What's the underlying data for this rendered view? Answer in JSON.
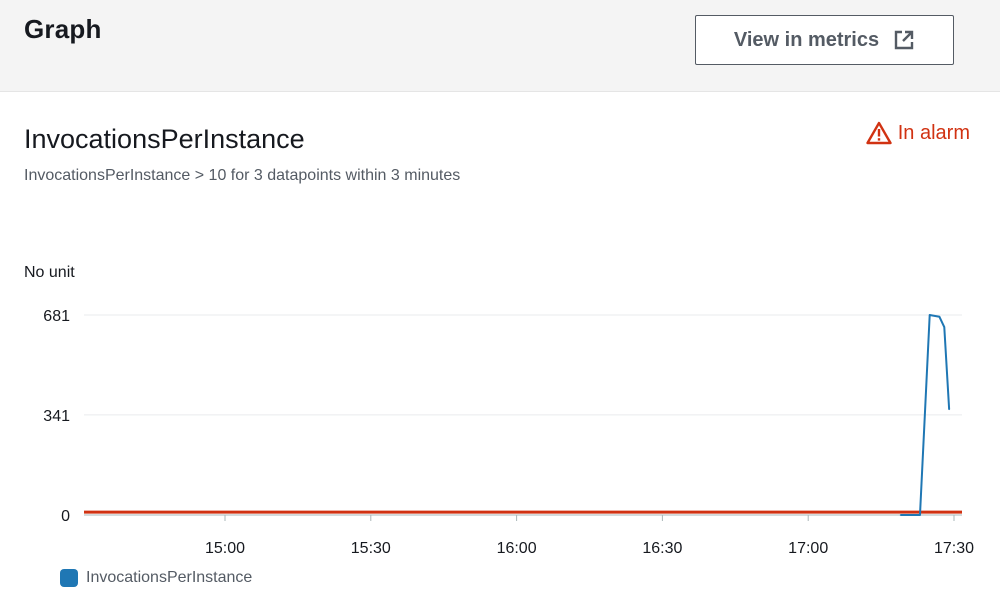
{
  "header": {
    "title": "Graph",
    "view_metrics_label": "View in metrics",
    "view_metrics_icon": "external-link-icon"
  },
  "panel": {
    "title": "InvocationsPerInstance",
    "subtitle": "InvocationsPerInstance > 10 for 3 datapoints within 3 minutes",
    "status": "In alarm",
    "status_icon": "warning-triangle-icon",
    "status_color": "#d13212"
  },
  "chart_data": {
    "type": "line",
    "ylabel": "No unit",
    "y_ticks": [
      0,
      341,
      681
    ],
    "ylim": [
      0,
      681
    ],
    "x_ticks": [
      "15:00",
      "15:30",
      "16:00",
      "16:30",
      "17:00",
      "17:30"
    ],
    "xlim": [
      "14:30",
      "17:30"
    ],
    "grid": true,
    "series": [
      {
        "name": "InvocationsPerInstance",
        "color": "#1f77b4",
        "points": [
          [
            "17:19",
            0
          ],
          [
            "17:23",
            0
          ],
          [
            "17:25",
            681
          ],
          [
            "17:27",
            675
          ],
          [
            "17:28",
            640
          ],
          [
            "17:29",
            360
          ]
        ]
      }
    ],
    "threshold": {
      "value": 10,
      "color": "#d13212"
    },
    "legend": "bottom-left"
  }
}
